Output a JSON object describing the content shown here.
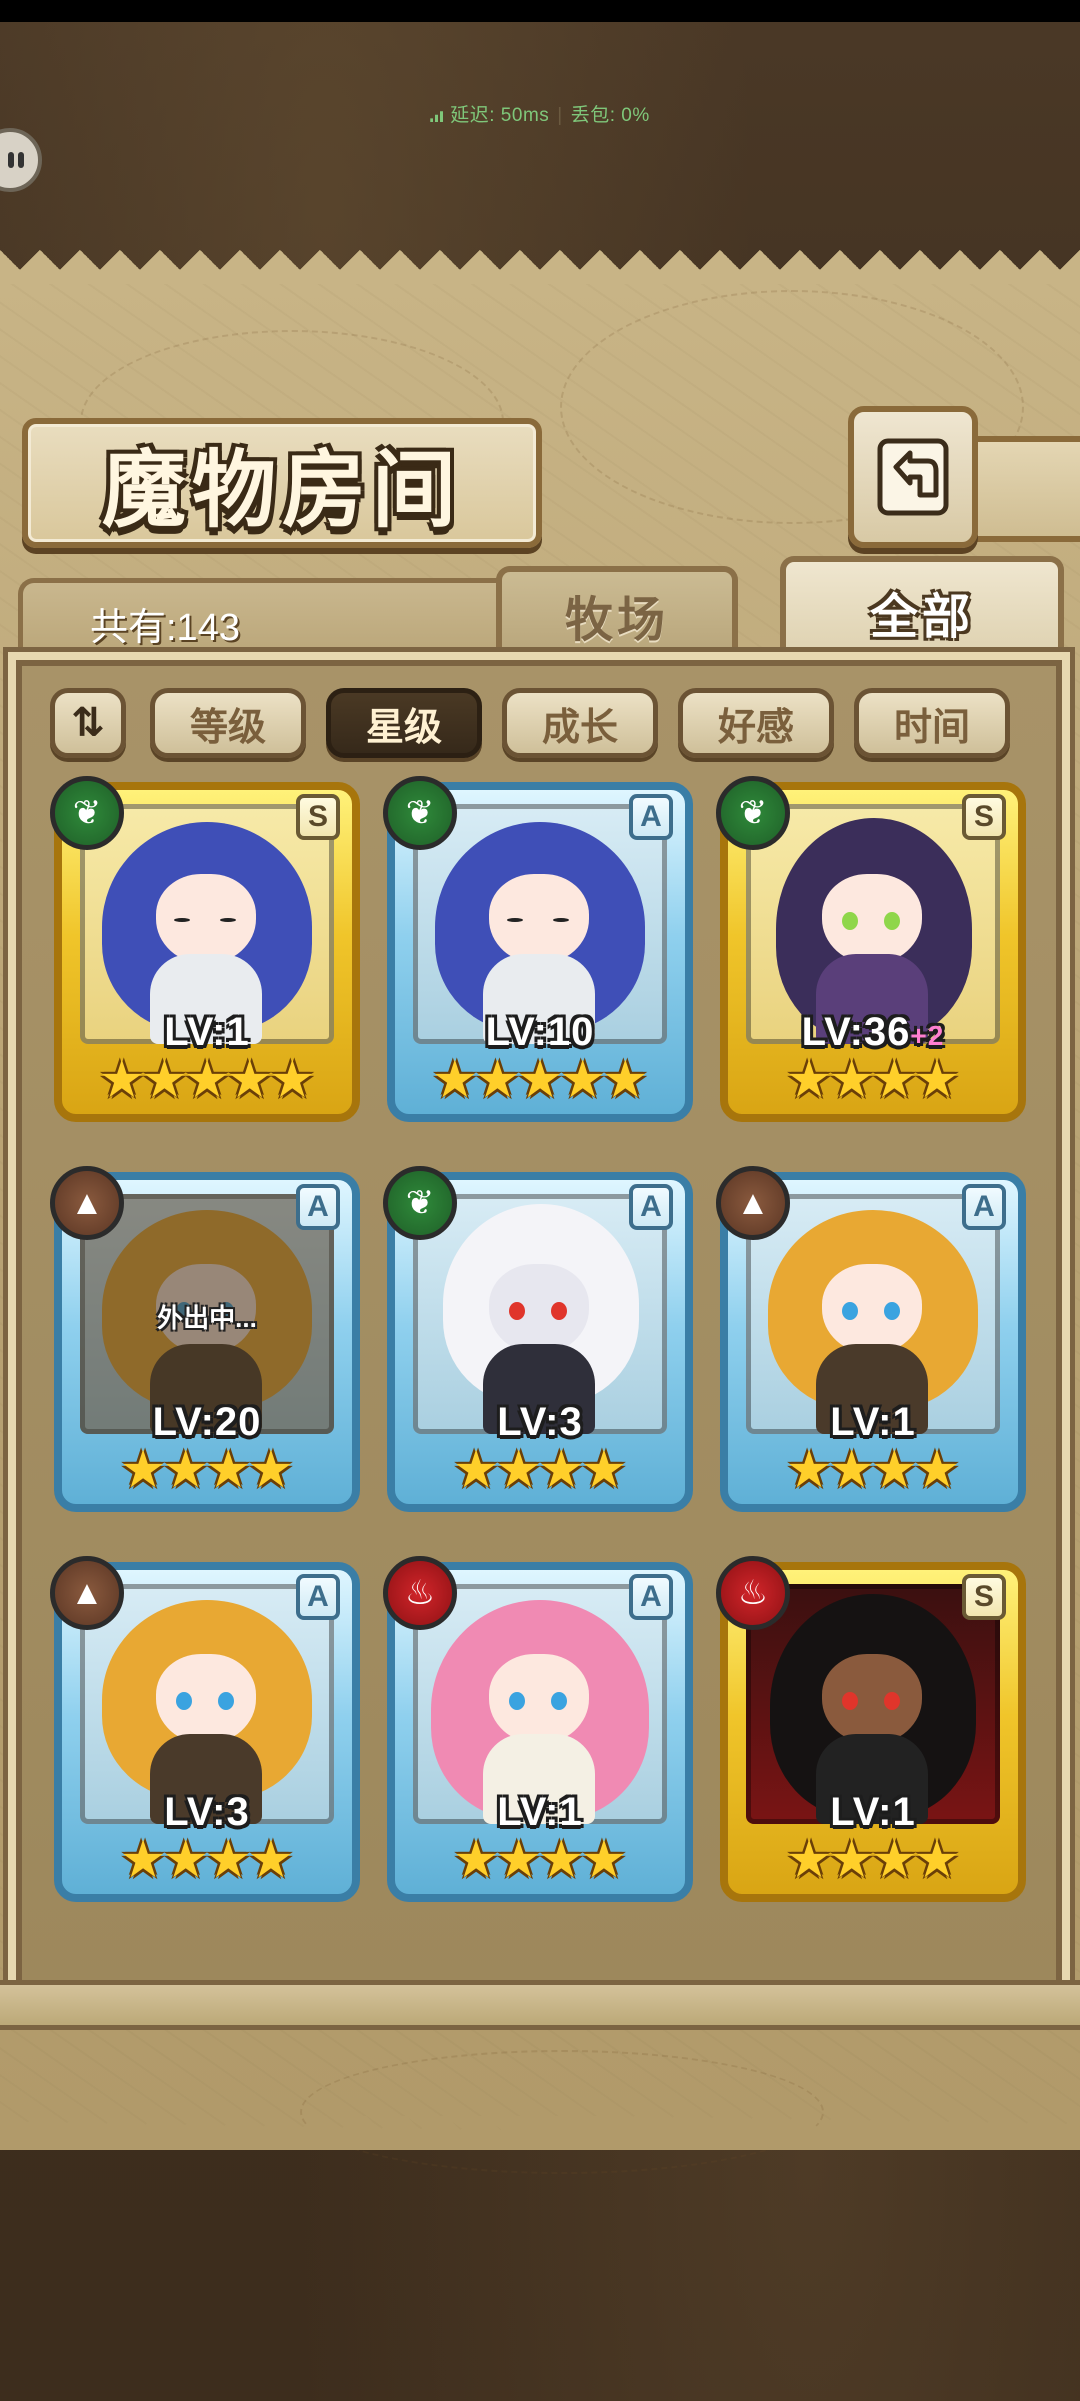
{
  "network": {
    "latency": "延迟: 50ms",
    "loss": "丢包: 0%"
  },
  "title": "魔物房间",
  "count": "共有:143",
  "tabs": [
    {
      "label": "牧场",
      "active": false
    },
    {
      "label": "全部",
      "active": true
    }
  ],
  "sort_chips": [
    {
      "label": "等级",
      "active": false
    },
    {
      "label": "星级",
      "active": true
    },
    {
      "label": "成长",
      "active": false
    },
    {
      "label": "好感",
      "active": false
    },
    {
      "label": "时间",
      "active": false
    }
  ],
  "monsters": [
    {
      "level": "LV:1",
      "plus": "",
      "rank": "S",
      "frame": "gold",
      "element": "leaf-icon",
      "stars": 5,
      "away": ""
    },
    {
      "level": "LV:10",
      "plus": "",
      "rank": "A",
      "frame": "blue",
      "element": "leaf-icon",
      "stars": 5,
      "away": ""
    },
    {
      "level": "LV:36",
      "plus": "+2",
      "rank": "S",
      "frame": "gold",
      "element": "leaf-icon",
      "stars": 4,
      "away": ""
    },
    {
      "level": "LV:20",
      "plus": "",
      "rank": "A",
      "frame": "blue",
      "element": "rock-icon",
      "stars": 4,
      "away": "外出中..."
    },
    {
      "level": "LV:3",
      "plus": "",
      "rank": "A",
      "frame": "blue",
      "element": "leaf-icon",
      "stars": 4,
      "away": ""
    },
    {
      "level": "LV:1",
      "plus": "",
      "rank": "A",
      "frame": "blue",
      "element": "rock-icon",
      "stars": 4,
      "away": ""
    },
    {
      "level": "LV:3",
      "plus": "",
      "rank": "A",
      "frame": "blue",
      "element": "rock-icon",
      "stars": 4,
      "away": ""
    },
    {
      "level": "LV:1",
      "plus": "",
      "rank": "A",
      "frame": "blue",
      "element": "fire-icon",
      "stars": 4,
      "away": ""
    },
    {
      "level": "LV:1",
      "plus": "",
      "rank": "S",
      "frame": "gold",
      "element": "fire-icon",
      "stars": 4,
      "away": ""
    }
  ],
  "colors": {
    "gold_frame": "#f0c52a",
    "blue_frame": "#8fd0ee",
    "active_chip": "#36291a",
    "network_text": "#7fc77a"
  }
}
